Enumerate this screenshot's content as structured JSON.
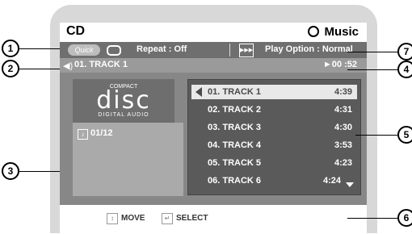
{
  "header": {
    "title": "CD",
    "mode": "Music"
  },
  "info_bar": {
    "quick": "Quick",
    "repeat": "Repeat : Off",
    "play_option": "Play Option : Normal"
  },
  "now_playing": {
    "track": "01. TRACK 1",
    "time": "►00 :52"
  },
  "logo": {
    "top": "COMPACT",
    "main": "disc",
    "bottom": "DIGITAL AUDIO"
  },
  "counter": "01/12",
  "tracks": [
    {
      "name": "01. TRACK 1",
      "time": "4:39"
    },
    {
      "name": "02. TRACK 2",
      "time": "4:31"
    },
    {
      "name": "03. TRACK 3",
      "time": "4:30"
    },
    {
      "name": "04. TRACK 4",
      "time": "3:53"
    },
    {
      "name": "05. TRACK 5",
      "time": "4:23"
    },
    {
      "name": "06. TRACK 6",
      "time": "4:24"
    }
  ],
  "footer": {
    "move": "MOVE",
    "select": "SELECT"
  },
  "callouts": [
    "1",
    "2",
    "3",
    "4",
    "5",
    "6",
    "7"
  ]
}
